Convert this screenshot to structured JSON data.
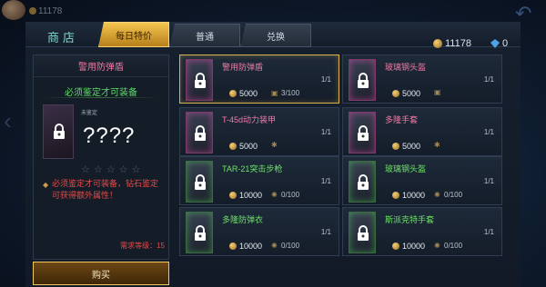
{
  "top_left_coin": "11178",
  "header": {
    "title": "商店"
  },
  "tabs": [
    {
      "label": "每日特价",
      "active": true
    },
    {
      "label": "普通",
      "active": false
    },
    {
      "label": "兑换",
      "active": false
    }
  ],
  "currency": {
    "gold": "11178",
    "gems": "0"
  },
  "detail": {
    "item_name": "警用防弹盾",
    "requirement": "必须鉴定才可装备",
    "unappraised_label": "未鉴定",
    "hidden_name": "????",
    "stars_text": "☆☆☆☆☆",
    "stars_filled": 0,
    "stars_total": 5,
    "warning": "必须鉴定才可装备，钻石鉴定可获得额外属性！",
    "required_level": "需求等级：15",
    "buy_label": "购买"
  },
  "items": [
    {
      "name": "警用防弹盾",
      "count": "1/1",
      "price": "5000",
      "stock": "3/100",
      "rarity": "pink",
      "selected": true,
      "stock_icon": "tag-icon"
    },
    {
      "name": "玻璃钢头盔",
      "count": "1/1",
      "price": "5000",
      "stock": "",
      "rarity": "pink",
      "selected": false,
      "stock_icon": "tag-icon"
    },
    {
      "name": "T-45d动力装甲",
      "count": "1/1",
      "price": "5000",
      "stock": "",
      "rarity": "pink",
      "selected": false,
      "stock_icon": "star-icon"
    },
    {
      "name": "多隆手套",
      "count": "1/1",
      "price": "5000",
      "stock": "",
      "rarity": "pink",
      "selected": false,
      "stock_icon": "star-icon"
    },
    {
      "name": "TAR-21突击步枪",
      "count": "1/1",
      "price": "10000",
      "stock": "0/100",
      "rarity": "green",
      "selected": false,
      "stock_icon": "gear-icon"
    },
    {
      "name": "玻璃钢头盔",
      "count": "1/1",
      "price": "10000",
      "stock": "0/100",
      "rarity": "green",
      "selected": false,
      "stock_icon": "gear-icon"
    },
    {
      "name": "多隆防弹衣",
      "count": "1/1",
      "price": "10000",
      "stock": "0/100",
      "rarity": "green",
      "selected": false,
      "stock_icon": "gear-icon"
    },
    {
      "name": "斯派克特手套",
      "count": "1/1",
      "price": "10000",
      "stock": "0/100",
      "rarity": "green",
      "selected": false,
      "stock_icon": "gear-icon"
    }
  ],
  "colors": {
    "accent_gold": "#f4c54f",
    "rarity_pink": "#f07aa5",
    "rarity_green": "#6fe06a",
    "warning_red": "#e54a4a"
  }
}
